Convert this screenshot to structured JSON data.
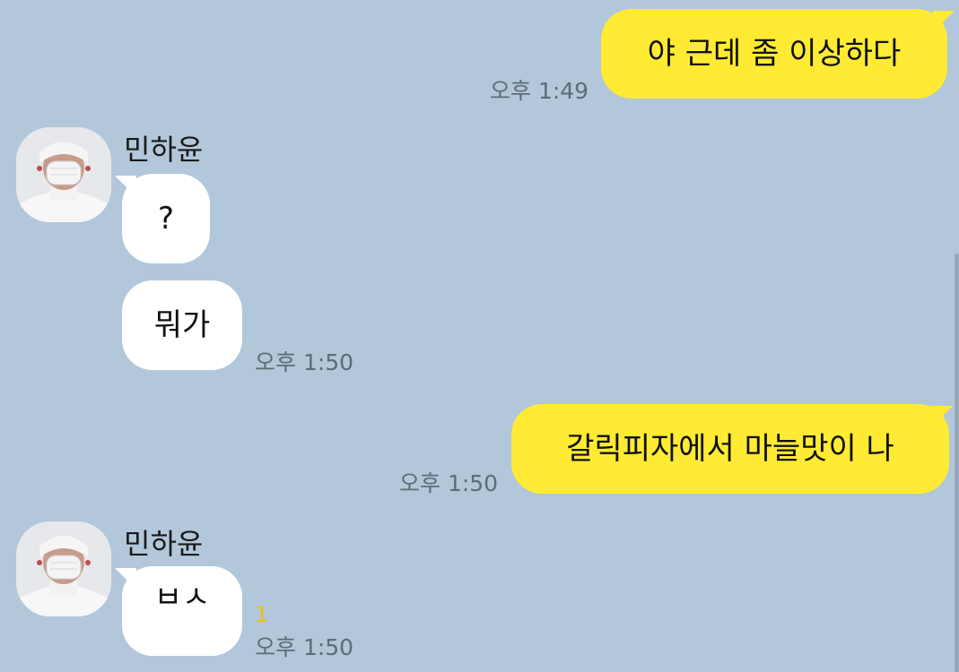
{
  "messages": [
    {
      "text": "야 근데 좀 이상하다",
      "time": "오후 1:49"
    },
    {
      "sender": "민하윤",
      "text": "?"
    },
    {
      "text": "뭐가",
      "time": "오후 1:50"
    },
    {
      "text": "갈릭피자에서 마늘맛이 나",
      "time": "오후 1:50"
    },
    {
      "sender": "민하윤",
      "text": "ㅂㅅ",
      "time": "오후 1:50",
      "unread": "1"
    }
  ],
  "colors": {
    "background": "#b2c7da",
    "my_bubble": "#ffeb33",
    "their_bubble": "#ffffff",
    "timestamp": "#5f6b76",
    "unread_count": "#e7c400"
  },
  "icons": {
    "avatar": "profile-photo-person-white-beanie-mask"
  }
}
